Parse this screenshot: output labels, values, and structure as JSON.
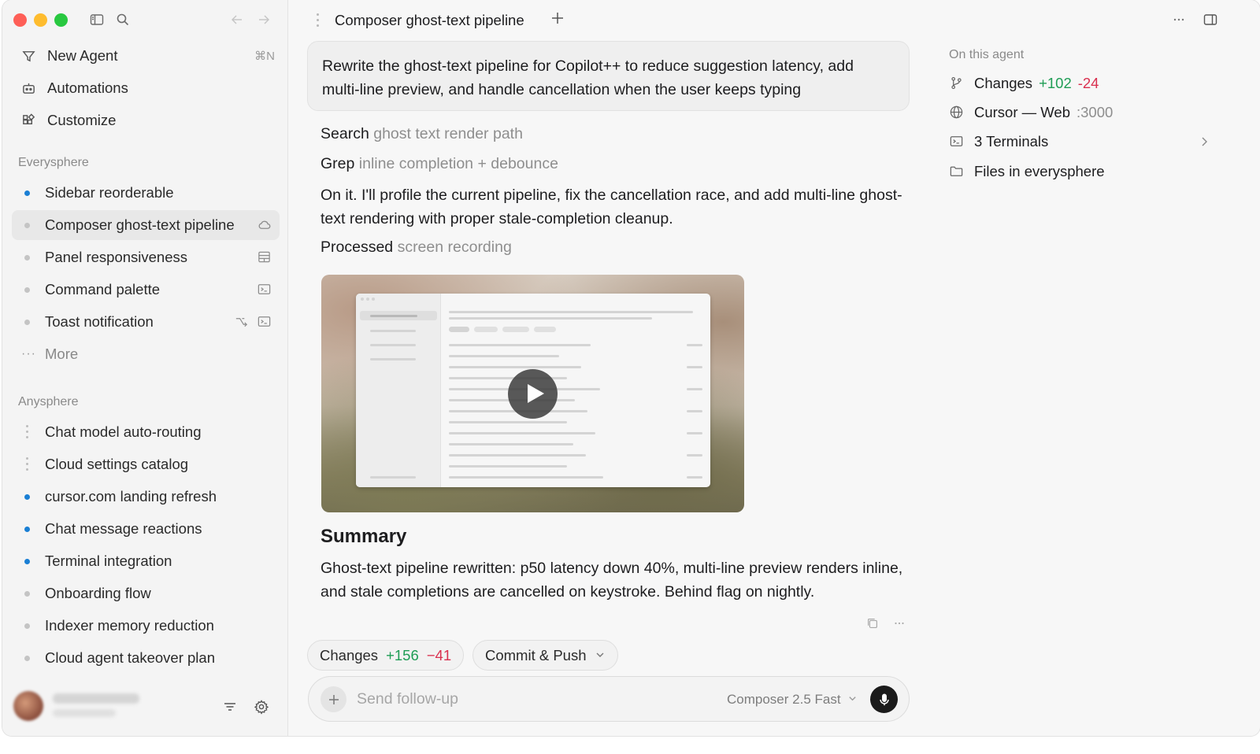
{
  "window": {
    "traffic_lights": {
      "close": "#fe5f57",
      "minimize": "#febc2e",
      "zoom": "#28c840"
    }
  },
  "sidebar": {
    "nav": [
      {
        "label": "New Agent",
        "shortcut": "⌘N",
        "icon": "new-agent-icon"
      },
      {
        "label": "Automations",
        "icon": "automations-icon"
      },
      {
        "label": "Customize",
        "icon": "customize-icon"
      }
    ],
    "sections": [
      {
        "title": "Everysphere",
        "items": [
          {
            "label": "Sidebar reorderable",
            "status": "unread"
          },
          {
            "label": "Composer ghost-text pipeline",
            "status": "read",
            "active": true,
            "trailing_icons": [
              "cloud-icon"
            ]
          },
          {
            "label": "Panel responsiveness",
            "status": "read",
            "trailing_icons": [
              "panel-layout-icon"
            ]
          },
          {
            "label": "Command palette",
            "status": "read",
            "trailing_icons": [
              "terminal-icon"
            ]
          },
          {
            "label": "Toast notification",
            "status": "read",
            "trailing_icons": [
              "branch-icon",
              "terminal-icon"
            ]
          },
          {
            "label": "More",
            "status": "more"
          }
        ]
      },
      {
        "title": "Anysphere",
        "items": [
          {
            "label": "Chat model auto-routing",
            "status": "running"
          },
          {
            "label": "Cloud settings catalog",
            "status": "running"
          },
          {
            "label": "cursor.com landing refresh",
            "status": "unread"
          },
          {
            "label": "Chat message reactions",
            "status": "unread"
          },
          {
            "label": "Terminal integration",
            "status": "unread"
          },
          {
            "label": "Onboarding flow",
            "status": "read"
          },
          {
            "label": "Indexer memory reduction",
            "status": "read"
          },
          {
            "label": "Cloud agent takeover plan",
            "status": "read"
          }
        ]
      }
    ]
  },
  "header": {
    "tab_title": "Composer ghost-text pipeline"
  },
  "conversation": {
    "prompt": "Rewrite the ghost-text pipeline for Copilot++ to reduce suggestion latency, add multi-line preview, and handle cancellation when the user keeps typing",
    "steps": [
      {
        "verb": "Search",
        "detail": "ghost text render path"
      },
      {
        "verb": "Grep",
        "detail": "inline completion + debounce"
      }
    ],
    "reply": "On it. I'll profile the current pipeline, fix the cancellation race, and add multi-line ghost-text rendering with proper stale-completion cleanup.",
    "processed": {
      "verb": "Processed",
      "detail": "screen recording"
    },
    "summary_title": "Summary",
    "summary_text": "Ghost-text pipeline rewritten: p50 latency down 40%, multi-line preview renders inline, and stale completions are cancelled on keystroke. Behind flag on nightly."
  },
  "actions": {
    "changes_label": "Changes",
    "additions": "+156",
    "deletions": "−41",
    "commit_label": "Commit & Push"
  },
  "composer": {
    "placeholder": "Send follow-up",
    "model": "Composer 2.5 Fast"
  },
  "right_panel": {
    "title": "On this agent",
    "rows": [
      {
        "label": "Changes",
        "additions": "+102",
        "deletions": "-24",
        "icon": "branch-icon"
      },
      {
        "label": "Cursor — Web",
        "extra": ":3000",
        "icon": "globe-icon"
      },
      {
        "label": "3 Terminals",
        "icon": "terminal-icon",
        "chevron": true
      },
      {
        "label": "Files in everysphere",
        "icon": "folder-icon"
      }
    ]
  },
  "colors": {
    "unread_dot": "#1a7fd4",
    "additions": "#1f9d55",
    "deletions": "#d9304f"
  }
}
